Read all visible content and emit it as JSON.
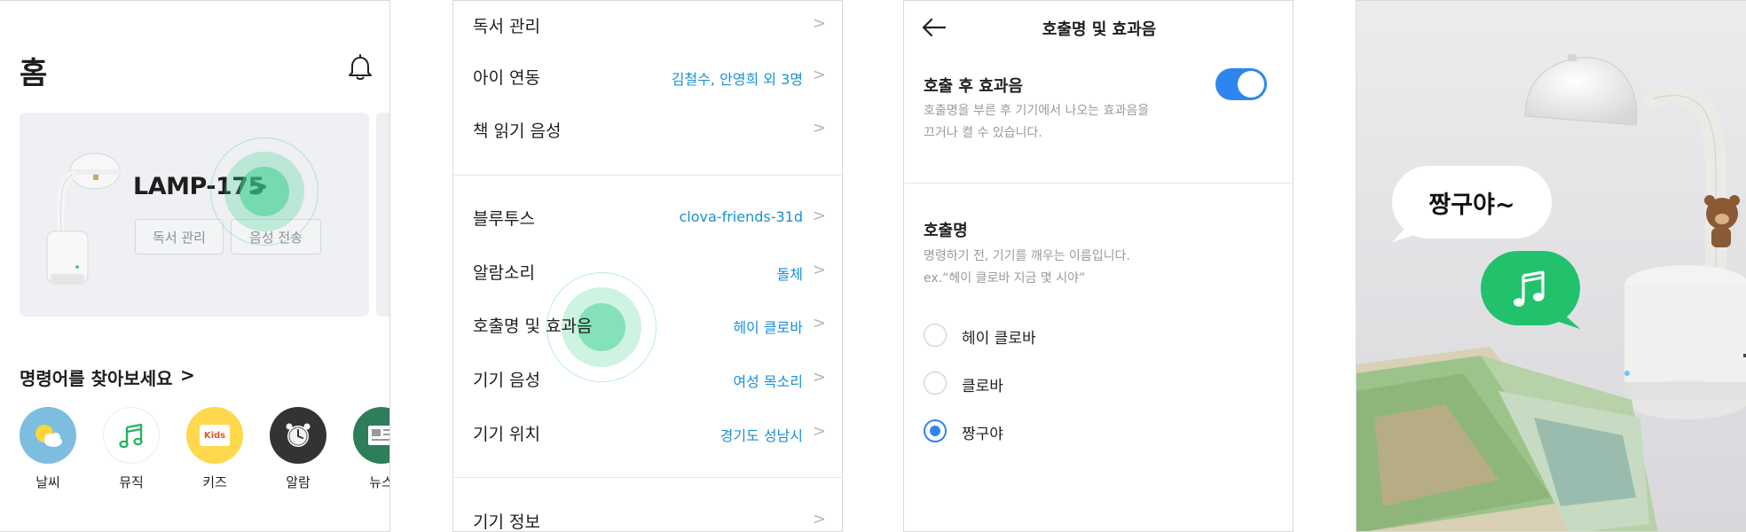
{
  "home": {
    "title": "홈",
    "device": {
      "name": "LAMP-175",
      "chevron": ">",
      "chip_reading": "독서 관리",
      "chip_voice": "음성 전송"
    },
    "commands_title": "명령어를 찾아보세요",
    "commands_chevron": ">",
    "categories": [
      {
        "label": "날씨",
        "icon": "weather-icon",
        "color": "#7dbde0"
      },
      {
        "label": "뮤직",
        "icon": "music-note-icon",
        "color": "#ffffff"
      },
      {
        "label": "키즈",
        "icon": "kids-book-icon",
        "color": "#ffd84d",
        "badge": "Kids"
      },
      {
        "label": "알람",
        "icon": "alarm-clock-icon",
        "color": "#333333"
      },
      {
        "label": "뉴스",
        "icon": "news-icon",
        "color": "#2e7d5b"
      }
    ]
  },
  "settings": {
    "chevron": ">",
    "rows": [
      {
        "label": "독서 관리",
        "value": ""
      },
      {
        "label": "아이 연동",
        "value": "김철수, 안영희 외 3명"
      },
      {
        "label": "책 읽기 음성",
        "value": ""
      },
      {
        "label": "블루투스",
        "value": "clova-friends-31d"
      },
      {
        "label": "알람소리",
        "value": "돌체"
      },
      {
        "label": "호출명 및 효과음",
        "value": "헤이 클로바"
      },
      {
        "label": "기기 음성",
        "value": "여성 목소리"
      },
      {
        "label": "기기 위치",
        "value": "경기도 성남시"
      },
      {
        "label": "기기 정보",
        "value": ""
      }
    ]
  },
  "wake": {
    "title": "호출명 및 효과음",
    "effect_title": "호출 후 효과음",
    "effect_desc_1": "호출명을 부른 후 기기에서 나오는 효과음을",
    "effect_desc_2": "끄거나 켤 수 있습니다.",
    "effect_on": true,
    "name_title": "호출명",
    "name_desc_1": "명령하기 전, 기기를 깨우는 이름입니다.",
    "name_desc_2": "ex.“헤이 클로바 지금 몇 시야”",
    "options": [
      {
        "label": "헤이 클로바",
        "selected": false
      },
      {
        "label": "클로바",
        "selected": false
      },
      {
        "label": "짱구야",
        "selected": true
      }
    ]
  },
  "photo": {
    "speech": "짱구야~",
    "reply_icon": "music-note-icon"
  },
  "colors": {
    "accent_blue": "#2d86ee",
    "value_blue": "#1a8fd6",
    "touch_green": "#3ccf8e",
    "bubble_green": "#22c26d"
  }
}
